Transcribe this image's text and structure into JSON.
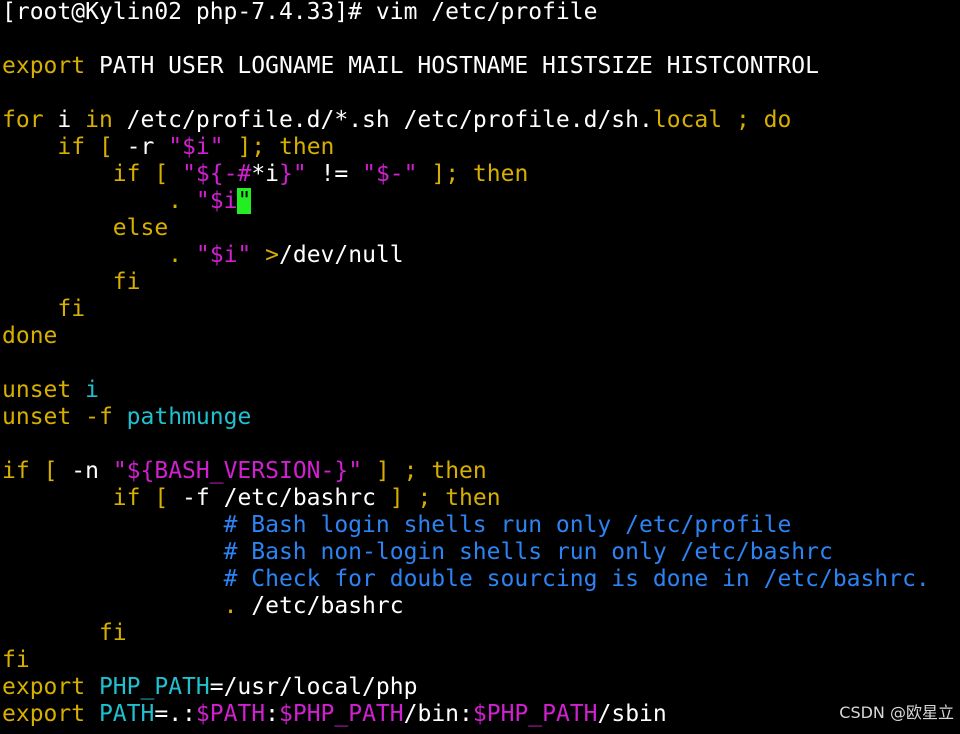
{
  "terminal": {
    "lines": [
      {
        "tokens": [
          {
            "text": "[root@Kylin02 php-7.4.33]# vim /etc/profile",
            "kind": "plain"
          }
        ]
      },
      {
        "tokens": []
      },
      {
        "tokens": [
          {
            "text": "export",
            "kind": "keyword"
          },
          {
            "text": " PATH USER LOGNAME MAIL HOSTNAME HISTSIZE HISTCONTROL",
            "kind": "plain"
          }
        ]
      },
      {
        "tokens": []
      },
      {
        "tokens": [
          {
            "text": "for",
            "kind": "keyword"
          },
          {
            "text": " i ",
            "kind": "plain"
          },
          {
            "text": "in",
            "kind": "keyword"
          },
          {
            "text": " /etc/profile.d/*.sh /etc/profile.d/sh.",
            "kind": "plain"
          },
          {
            "text": "local",
            "kind": "keyword"
          },
          {
            "text": " ",
            "kind": "plain"
          },
          {
            "text": ";",
            "kind": "keyword"
          },
          {
            "text": " ",
            "kind": "plain"
          },
          {
            "text": "do",
            "kind": "keyword"
          }
        ]
      },
      {
        "tokens": [
          {
            "text": "    ",
            "kind": "plain"
          },
          {
            "text": "if",
            "kind": "keyword"
          },
          {
            "text": " ",
            "kind": "plain"
          },
          {
            "text": "[",
            "kind": "keyword"
          },
          {
            "text": " -r ",
            "kind": "plain"
          },
          {
            "text": "\"$i\"",
            "kind": "string"
          },
          {
            "text": " ",
            "kind": "plain"
          },
          {
            "text": "];",
            "kind": "keyword"
          },
          {
            "text": " ",
            "kind": "plain"
          },
          {
            "text": "then",
            "kind": "keyword"
          }
        ]
      },
      {
        "tokens": [
          {
            "text": "        ",
            "kind": "plain"
          },
          {
            "text": "if",
            "kind": "keyword"
          },
          {
            "text": " ",
            "kind": "plain"
          },
          {
            "text": "[",
            "kind": "keyword"
          },
          {
            "text": " ",
            "kind": "plain"
          },
          {
            "text": "\"${-#",
            "kind": "string"
          },
          {
            "text": "*i",
            "kind": "plain"
          },
          {
            "text": "}\"",
            "kind": "string"
          },
          {
            "text": " != ",
            "kind": "plain"
          },
          {
            "text": "\"$-\"",
            "kind": "string"
          },
          {
            "text": " ",
            "kind": "plain"
          },
          {
            "text": "];",
            "kind": "keyword"
          },
          {
            "text": " ",
            "kind": "plain"
          },
          {
            "text": "then",
            "kind": "keyword"
          }
        ]
      },
      {
        "tokens": [
          {
            "text": "            ",
            "kind": "plain"
          },
          {
            "text": ".",
            "kind": "keyword"
          },
          {
            "text": " ",
            "kind": "plain"
          },
          {
            "text": "\"$i",
            "kind": "string"
          },
          {
            "text": "\"",
            "kind": "cursor"
          }
        ]
      },
      {
        "tokens": [
          {
            "text": "        ",
            "kind": "plain"
          },
          {
            "text": "else",
            "kind": "keyword"
          }
        ]
      },
      {
        "tokens": [
          {
            "text": "            ",
            "kind": "plain"
          },
          {
            "text": ".",
            "kind": "keyword"
          },
          {
            "text": " ",
            "kind": "plain"
          },
          {
            "text": "\"$i\"",
            "kind": "string"
          },
          {
            "text": " ",
            "kind": "plain"
          },
          {
            "text": ">",
            "kind": "keyword"
          },
          {
            "text": "/dev/null",
            "kind": "plain"
          }
        ]
      },
      {
        "tokens": [
          {
            "text": "        ",
            "kind": "plain"
          },
          {
            "text": "fi",
            "kind": "keyword"
          }
        ]
      },
      {
        "tokens": [
          {
            "text": "    ",
            "kind": "plain"
          },
          {
            "text": "fi",
            "kind": "keyword"
          }
        ]
      },
      {
        "tokens": [
          {
            "text": "done",
            "kind": "keyword"
          }
        ]
      },
      {
        "tokens": []
      },
      {
        "tokens": [
          {
            "text": "unset",
            "kind": "keyword"
          },
          {
            "text": " ",
            "kind": "plain"
          },
          {
            "text": "i",
            "kind": "var"
          }
        ]
      },
      {
        "tokens": [
          {
            "text": "unset",
            "kind": "keyword"
          },
          {
            "text": " ",
            "kind": "plain"
          },
          {
            "text": "-f",
            "kind": "keyword"
          },
          {
            "text": " ",
            "kind": "plain"
          },
          {
            "text": "pathmunge",
            "kind": "var"
          }
        ]
      },
      {
        "tokens": []
      },
      {
        "tokens": [
          {
            "text": "if",
            "kind": "keyword"
          },
          {
            "text": " ",
            "kind": "plain"
          },
          {
            "text": "[",
            "kind": "keyword"
          },
          {
            "text": " -n ",
            "kind": "plain"
          },
          {
            "text": "\"${BASH_VERSION-}\"",
            "kind": "string"
          },
          {
            "text": " ",
            "kind": "plain"
          },
          {
            "text": "]",
            "kind": "keyword"
          },
          {
            "text": " ",
            "kind": "plain"
          },
          {
            "text": ";",
            "kind": "keyword"
          },
          {
            "text": " ",
            "kind": "plain"
          },
          {
            "text": "then",
            "kind": "keyword"
          }
        ]
      },
      {
        "tokens": [
          {
            "text": "        ",
            "kind": "plain"
          },
          {
            "text": "if",
            "kind": "keyword"
          },
          {
            "text": " ",
            "kind": "plain"
          },
          {
            "text": "[",
            "kind": "keyword"
          },
          {
            "text": " -f /etc/bashrc ",
            "kind": "plain"
          },
          {
            "text": "]",
            "kind": "keyword"
          },
          {
            "text": " ",
            "kind": "plain"
          },
          {
            "text": ";",
            "kind": "keyword"
          },
          {
            "text": " ",
            "kind": "plain"
          },
          {
            "text": "then",
            "kind": "keyword"
          }
        ]
      },
      {
        "tokens": [
          {
            "text": "                ",
            "kind": "plain"
          },
          {
            "text": "# Bash login shells run only /etc/profile",
            "kind": "comment"
          }
        ]
      },
      {
        "tokens": [
          {
            "text": "                ",
            "kind": "plain"
          },
          {
            "text": "# Bash non-login shells run only /etc/bashrc",
            "kind": "comment"
          }
        ]
      },
      {
        "tokens": [
          {
            "text": "                ",
            "kind": "plain"
          },
          {
            "text": "# Check for double sourcing is done in /etc/bashrc.",
            "kind": "comment"
          }
        ]
      },
      {
        "tokens": [
          {
            "text": "                ",
            "kind": "plain"
          },
          {
            "text": ".",
            "kind": "keyword"
          },
          {
            "text": " /etc/bashrc",
            "kind": "plain"
          }
        ]
      },
      {
        "tokens": [
          {
            "text": "       ",
            "kind": "plain"
          },
          {
            "text": "fi",
            "kind": "keyword"
          }
        ]
      },
      {
        "tokens": [
          {
            "text": "fi",
            "kind": "keyword"
          }
        ]
      },
      {
        "tokens": [
          {
            "text": "export",
            "kind": "keyword"
          },
          {
            "text": " ",
            "kind": "plain"
          },
          {
            "text": "PHP_PATH",
            "kind": "var"
          },
          {
            "text": "=/usr/local/php",
            "kind": "plain"
          }
        ]
      },
      {
        "tokens": [
          {
            "text": "export",
            "kind": "keyword"
          },
          {
            "text": " ",
            "kind": "plain"
          },
          {
            "text": "PATH",
            "kind": "var"
          },
          {
            "text": "=.:",
            "kind": "plain"
          },
          {
            "text": "$PATH",
            "kind": "string"
          },
          {
            "text": ":",
            "kind": "plain"
          },
          {
            "text": "$PHP_PATH",
            "kind": "string"
          },
          {
            "text": "/bin:",
            "kind": "plain"
          },
          {
            "text": "$PHP_PATH",
            "kind": "string"
          },
          {
            "text": "/sbin",
            "kind": "plain"
          }
        ]
      }
    ]
  },
  "watermark": {
    "text": "CSDN @欧星立"
  },
  "colors": {
    "background": "#000000",
    "keyword": "#d7af00",
    "plain": "#ffffff",
    "string": "#d020d0",
    "variable": "#20c0d0",
    "comment": "#2c84f4",
    "cursor": "#22ee22"
  }
}
